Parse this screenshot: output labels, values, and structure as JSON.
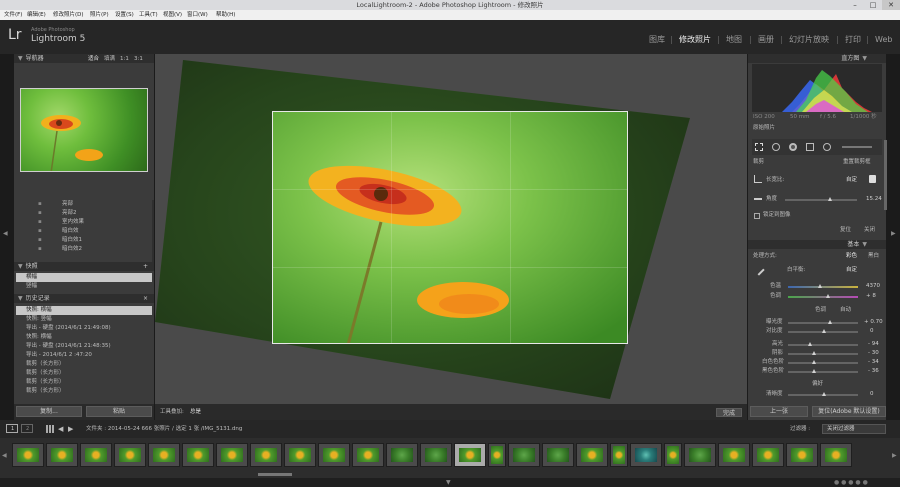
{
  "window": {
    "title": "LocalLightroom-2 - Adobe Photoshop Lightroom - 修改照片",
    "minimize": "–",
    "maximize": "□",
    "close": "✕"
  },
  "menu": [
    "文件(F)",
    "编辑(E)",
    "修改照片(D)",
    "照片(P)",
    "设置(S)",
    "工具(T)",
    "视图(V)",
    "窗口(W)",
    "帮助(H)"
  ],
  "brand": {
    "logo": "Lr",
    "line1": "Adobe Photoshop",
    "line2": "Lightroom 5"
  },
  "modules": [
    "图库",
    "修改照片",
    "地图",
    "画册",
    "幻灯片放映",
    "打印",
    "Web"
  ],
  "left": {
    "navigator_title": "导航器",
    "nav_zoom": [
      "适合",
      "填满",
      "1:1",
      "3:1"
    ],
    "presets": [
      "亮部",
      "亮部2",
      "室内效果",
      "暗白效",
      "暗白效1",
      "暗白效2"
    ],
    "snapshots_title": "快照",
    "snapshots": [
      "横幅",
      "竖幅"
    ],
    "history_title": "历史记录",
    "history": [
      "快照: 横幅",
      "快照: 竖幅",
      "导出 - 硬盘 (2014/6/1 21:49:08)",
      "快照: 横幅",
      "导出 - 硬盘 (2014/6/1 21:48:35)",
      "导出 - 2014/6/1 2 :47:20",
      "裁剪（长方形）",
      "裁剪（长方形）",
      "裁剪（长方形）",
      "裁剪（长方形）"
    ],
    "copy_btn": "复制...",
    "paste_btn": "粘贴"
  },
  "toolbar": {
    "overlay_label": "工具叠加:",
    "overlay_value": "总是",
    "done": "完成"
  },
  "right": {
    "histogram_title": "直方图",
    "histo_info": [
      "ISO 200",
      "50 mm",
      "f / 5.6",
      "1/1000 秒"
    ],
    "original_photo": "原始照片",
    "crop_title": "裁剪",
    "crop_lock": "重置裁剪框",
    "aspect_label": "长宽比:",
    "aspect_value": "自定",
    "angle_label": "角度",
    "angle_value": "15.24",
    "constrain": "锁定到图像",
    "reset": "复位",
    "close": "关闭",
    "basic_title": "基本",
    "treatment_label": "处理方式:",
    "treatment_color": "彩色",
    "treatment_bw": "黑白",
    "wb_label": "白平衡:",
    "wb_value": "自定",
    "temp_label": "色温",
    "temp_value": "4370",
    "tint_label": "色调",
    "tint_value": "+ 8",
    "tone_label": "色调",
    "tone_auto": "自动",
    "exposure_label": "曝光度",
    "exposure_value": "+ 0.70",
    "contrast_label": "对比度",
    "contrast_value": "0",
    "highlights_label": "高光",
    "highlights_value": "- 94",
    "shadows_label": "阴影",
    "shadows_value": "- 30",
    "whites_label": "白色色阶",
    "whites_value": "- 34",
    "blacks_label": "黑色色阶",
    "blacks_value": "- 36",
    "presence_label": "偏好",
    "clarity_label": "清晰度",
    "clarity_value": "0",
    "prev_btn": "上一张",
    "reset_btn": "复位(Adobe 默认设置)"
  },
  "filmstrip": {
    "page1": "1",
    "page2": "2",
    "path": "文件夹 : 2014-05-24  666 张照片 / 选定 1 张 /IMG_5131.dng",
    "filter_label": "过滤器 :",
    "filter_value": "关闭过滤器",
    "thumb_count": 26
  }
}
